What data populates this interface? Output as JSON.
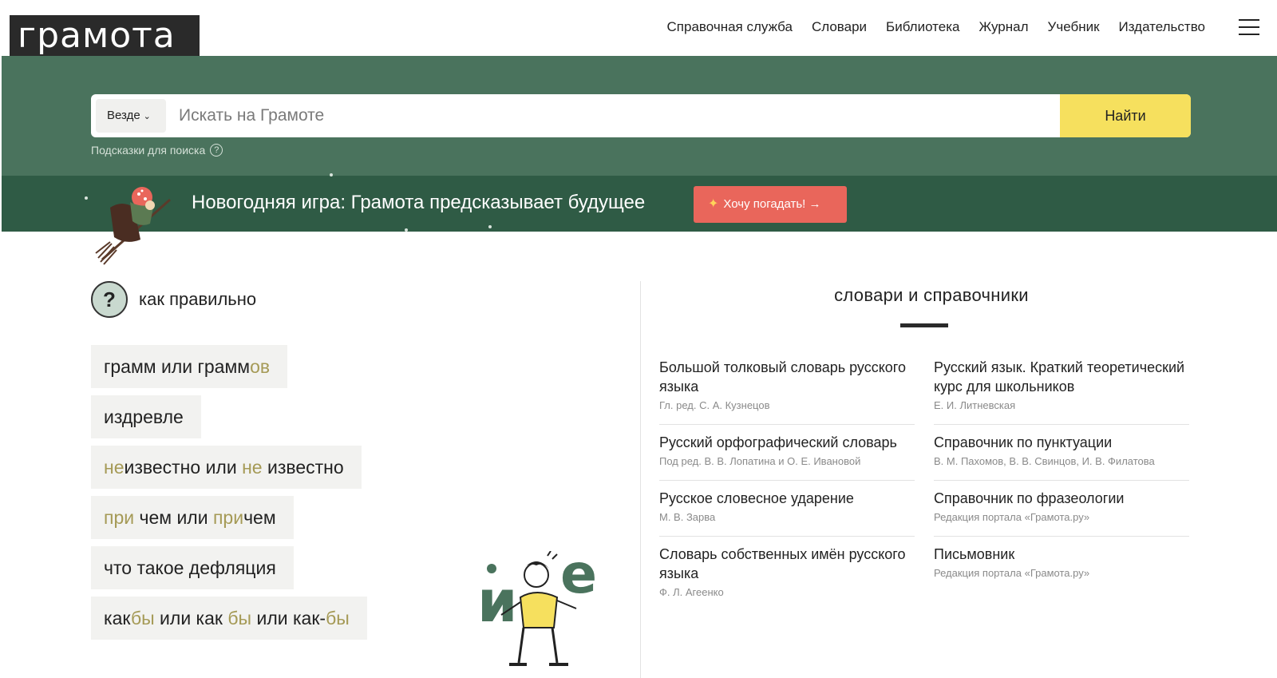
{
  "header": {
    "logo": "грамота",
    "nav": [
      "Справочная служба",
      "Словари",
      "Библиотека",
      "Журнал",
      "Учебник",
      "Издательство"
    ]
  },
  "search": {
    "scope": "Везде",
    "placeholder": "Искать на Грамоте",
    "button": "Найти",
    "hints": "Подсказки для поиска"
  },
  "promo": {
    "title": "Новогодняя игра: Грамота предсказывает будущее",
    "button": "Хочу погадать!"
  },
  "kak_pravilno": {
    "title": "как правильно",
    "items": [
      [
        {
          "t": "грамм или грамм"
        },
        {
          "t": "ов",
          "h": true
        }
      ],
      [
        {
          "t": "издревле"
        }
      ],
      [
        {
          "t": "не",
          "h": true
        },
        {
          "t": "известно или "
        },
        {
          "t": "не",
          "h": true
        },
        {
          "t": " известно"
        }
      ],
      [
        {
          "t": "при",
          "h": true
        },
        {
          "t": " чем или "
        },
        {
          "t": "при",
          "h": true
        },
        {
          "t": "чем"
        }
      ],
      [
        {
          "t": "что такое дефляция"
        }
      ],
      [
        {
          "t": "как"
        },
        {
          "t": "бы",
          "h": true
        },
        {
          "t": " или как "
        },
        {
          "t": "бы",
          "h": true
        },
        {
          "t": " или как-"
        },
        {
          "t": "бы",
          "h": true
        }
      ]
    ]
  },
  "dictionaries": {
    "title": "словари и справочники",
    "left": [
      {
        "title": "Большой толковый словарь русского языка",
        "author": "Гл. ред. С. А. Кузнецов"
      },
      {
        "title": "Русский орфографический словарь",
        "author": "Под ред. В. В. Лопатина и О. Е. Ивановой"
      },
      {
        "title": "Русское словесное ударение",
        "author": "М. В. Зарва"
      },
      {
        "title": "Словарь собственных имён русского языка",
        "author": "Ф. Л. Агеенко"
      }
    ],
    "right": [
      {
        "title": "Русский язык. Краткий теоретический курс для школьников",
        "author": "Е. И. Литневская"
      },
      {
        "title": "Справочник по пунктуации",
        "author": "В. М. Пахомов, В. В. Свинцов, И. В. Филатова"
      },
      {
        "title": "Справочник по фразеологии",
        "author": "Редакция портала «Грамота.ру»"
      },
      {
        "title": "Письмовник",
        "author": "Редакция портала «Грамота.ру»"
      }
    ]
  },
  "illustration": {
    "letters": [
      "и",
      "е"
    ]
  }
}
